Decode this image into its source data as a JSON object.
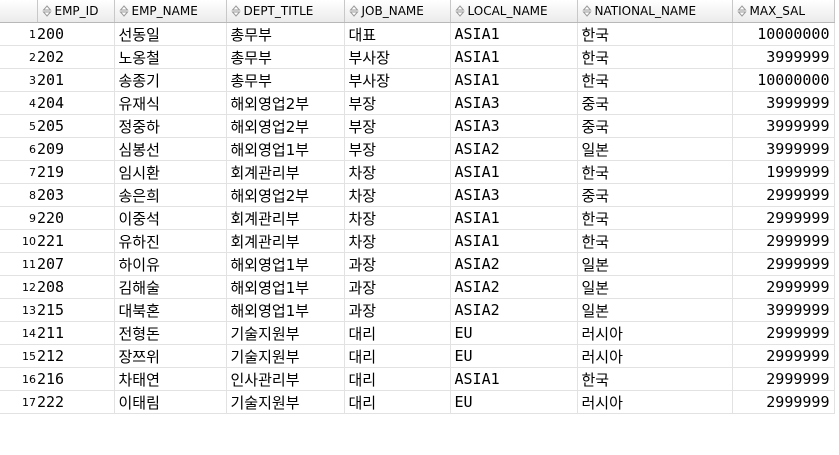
{
  "columns": {
    "emp_id": "EMP_ID",
    "emp_name": "EMP_NAME",
    "dept_title": "DEPT_TITLE",
    "job_name": "JOB_NAME",
    "local_name": "LOCAL_NAME",
    "national_name": "NATIONAL_NAME",
    "max_sal": "MAX_SAL"
  },
  "icons": {
    "sort": "sort-arrows-icon"
  },
  "rows": [
    {
      "rn": "1",
      "emp_id": "200",
      "emp_name": "선동일",
      "dept_title": "총무부",
      "job_name": "대표",
      "local_name": "ASIA1",
      "national_name": "한국",
      "max_sal": "10000000"
    },
    {
      "rn": "2",
      "emp_id": "202",
      "emp_name": "노옹철",
      "dept_title": "총무부",
      "job_name": "부사장",
      "local_name": "ASIA1",
      "national_name": "한국",
      "max_sal": "3999999"
    },
    {
      "rn": "3",
      "emp_id": "201",
      "emp_name": "송종기",
      "dept_title": "총무부",
      "job_name": "부사장",
      "local_name": "ASIA1",
      "national_name": "한국",
      "max_sal": "10000000"
    },
    {
      "rn": "4",
      "emp_id": "204",
      "emp_name": "유재식",
      "dept_title": "해외영업2부",
      "job_name": "부장",
      "local_name": "ASIA3",
      "national_name": "중국",
      "max_sal": "3999999"
    },
    {
      "rn": "5",
      "emp_id": "205",
      "emp_name": "정중하",
      "dept_title": "해외영업2부",
      "job_name": "부장",
      "local_name": "ASIA3",
      "national_name": "중국",
      "max_sal": "3999999"
    },
    {
      "rn": "6",
      "emp_id": "209",
      "emp_name": "심봉선",
      "dept_title": "해외영업1부",
      "job_name": "부장",
      "local_name": "ASIA2",
      "national_name": "일본",
      "max_sal": "3999999"
    },
    {
      "rn": "7",
      "emp_id": "219",
      "emp_name": "임시환",
      "dept_title": "회계관리부",
      "job_name": "차장",
      "local_name": "ASIA1",
      "national_name": "한국",
      "max_sal": "1999999"
    },
    {
      "rn": "8",
      "emp_id": "203",
      "emp_name": "송은희",
      "dept_title": "해외영업2부",
      "job_name": "차장",
      "local_name": "ASIA3",
      "national_name": "중국",
      "max_sal": "2999999"
    },
    {
      "rn": "9",
      "emp_id": "220",
      "emp_name": "이중석",
      "dept_title": "회계관리부",
      "job_name": "차장",
      "local_name": "ASIA1",
      "national_name": "한국",
      "max_sal": "2999999"
    },
    {
      "rn": "10",
      "emp_id": "221",
      "emp_name": "유하진",
      "dept_title": "회계관리부",
      "job_name": "차장",
      "local_name": "ASIA1",
      "national_name": "한국",
      "max_sal": "2999999"
    },
    {
      "rn": "11",
      "emp_id": "207",
      "emp_name": "하이유",
      "dept_title": "해외영업1부",
      "job_name": "과장",
      "local_name": "ASIA2",
      "national_name": "일본",
      "max_sal": "2999999"
    },
    {
      "rn": "12",
      "emp_id": "208",
      "emp_name": "김해술",
      "dept_title": "해외영업1부",
      "job_name": "과장",
      "local_name": "ASIA2",
      "national_name": "일본",
      "max_sal": "2999999"
    },
    {
      "rn": "13",
      "emp_id": "215",
      "emp_name": "대북혼",
      "dept_title": "해외영업1부",
      "job_name": "과장",
      "local_name": "ASIA2",
      "national_name": "일본",
      "max_sal": "3999999"
    },
    {
      "rn": "14",
      "emp_id": "211",
      "emp_name": "전형돈",
      "dept_title": "기술지원부",
      "job_name": "대리",
      "local_name": "EU",
      "national_name": "러시아",
      "max_sal": "2999999"
    },
    {
      "rn": "15",
      "emp_id": "212",
      "emp_name": "장쯔위",
      "dept_title": "기술지원부",
      "job_name": "대리",
      "local_name": "EU",
      "national_name": "러시아",
      "max_sal": "2999999"
    },
    {
      "rn": "16",
      "emp_id": "216",
      "emp_name": "차태연",
      "dept_title": "인사관리부",
      "job_name": "대리",
      "local_name": "ASIA1",
      "national_name": "한국",
      "max_sal": "2999999"
    },
    {
      "rn": "17",
      "emp_id": "222",
      "emp_name": "이태림",
      "dept_title": "기술지원부",
      "job_name": "대리",
      "local_name": "EU",
      "national_name": "러시아",
      "max_sal": "2999999"
    }
  ]
}
